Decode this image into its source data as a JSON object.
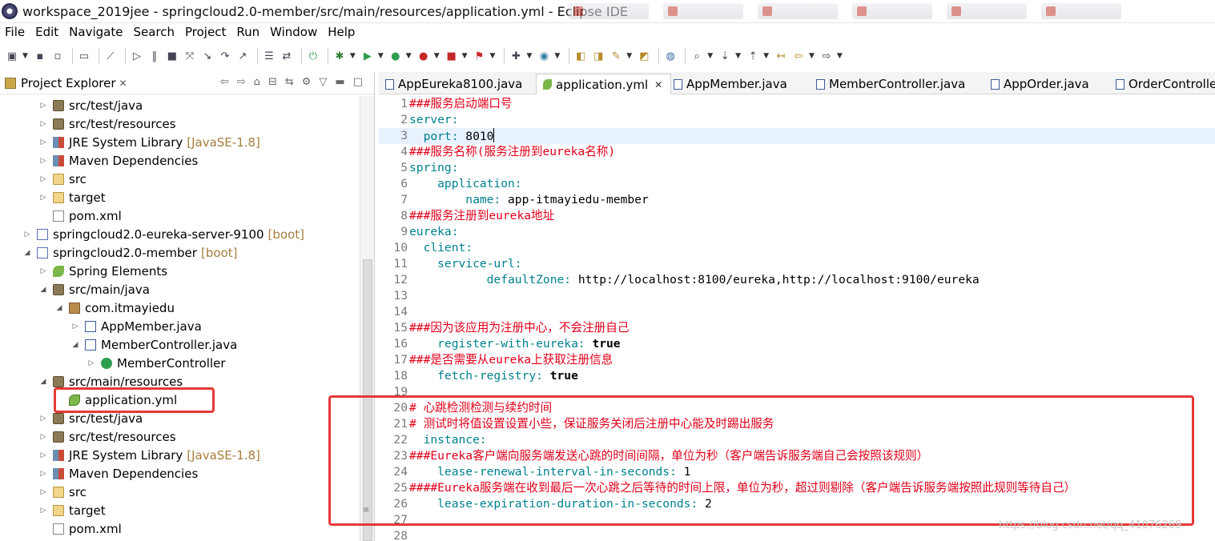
{
  "window": {
    "title": "workspace_2019jee - springcloud2.0-member/src/main/resources/application.yml - Eclipse IDE"
  },
  "menu": [
    "File",
    "Edit",
    "Navigate",
    "Search",
    "Project",
    "Run",
    "Window",
    "Help"
  ],
  "explorer": {
    "title": "Project Explorer",
    "close": "✕",
    "rows": [
      {
        "label": "src/test/java",
        "icon": "package-folder-icon",
        "twisty": "collapsed"
      },
      {
        "label": "src/test/resources",
        "icon": "package-folder-icon",
        "twisty": "collapsed"
      },
      {
        "label": "JRE System Library",
        "decoration": "[JavaSE-1.8]",
        "icon": "library-icon",
        "twisty": "collapsed"
      },
      {
        "label": "Maven Dependencies",
        "icon": "library-icon",
        "twisty": "collapsed"
      },
      {
        "label": "src",
        "icon": "folder-icon",
        "twisty": "collapsed"
      },
      {
        "label": "target",
        "icon": "folder-icon",
        "twisty": "collapsed"
      },
      {
        "label": "pom.xml",
        "icon": "xml-file-icon",
        "twisty": "none"
      },
      {
        "label": "springcloud2.0-eureka-server-9100",
        "decoration": "[boot]",
        "icon": "maven-project-icon",
        "twisty": "collapsed"
      },
      {
        "label": "springcloud2.0-member",
        "decoration": "[boot]",
        "icon": "maven-project-icon",
        "twisty": "expanded"
      },
      {
        "label": "Spring Elements",
        "icon": "spring-icon",
        "twisty": "collapsed"
      },
      {
        "label": "src/main/java",
        "icon": "package-folder-icon",
        "twisty": "expanded"
      },
      {
        "label": "com.itmayiedu",
        "icon": "package-icon",
        "twisty": "expanded"
      },
      {
        "label": "AppMember.java",
        "icon": "java-file-icon",
        "twisty": "collapsed"
      },
      {
        "label": "MemberController.java",
        "icon": "java-file-icon",
        "twisty": "expanded"
      },
      {
        "label": "MemberController",
        "icon": "class-icon",
        "twisty": "collapsed"
      },
      {
        "label": "src/main/resources",
        "icon": "package-folder-icon",
        "twisty": "expanded"
      },
      {
        "label": "application.yml",
        "icon": "yml-file-icon",
        "twisty": "none"
      },
      {
        "label": "src/test/java",
        "icon": "package-folder-icon",
        "twisty": "collapsed"
      },
      {
        "label": "src/test/resources",
        "icon": "package-folder-icon",
        "twisty": "collapsed"
      },
      {
        "label": "JRE System Library",
        "decoration": "[JavaSE-1.8]",
        "icon": "library-icon",
        "twisty": "collapsed"
      },
      {
        "label": "Maven Dependencies",
        "icon": "library-icon",
        "twisty": "collapsed"
      },
      {
        "label": "src",
        "icon": "folder-icon",
        "twisty": "collapsed"
      },
      {
        "label": "target",
        "icon": "folder-icon",
        "twisty": "collapsed"
      },
      {
        "label": "pom.xml",
        "icon": "xml-file-icon",
        "twisty": "none"
      }
    ]
  },
  "editor": {
    "tabs": [
      {
        "label": "AppEureka8100.java",
        "active": false
      },
      {
        "label": "application.yml",
        "active": true,
        "close": "✕"
      },
      {
        "label": "AppMember.java",
        "active": false
      },
      {
        "label": "MemberController.java",
        "active": false
      },
      {
        "label": "AppOrder.java",
        "active": false
      },
      {
        "label": "OrderControlle",
        "active": false
      }
    ],
    "lines": [
      {
        "n": "1",
        "tokens": [
          {
            "t": "###服务启动端口号",
            "c": "comment"
          }
        ]
      },
      {
        "n": "2",
        "tokens": [
          {
            "t": "server:",
            "c": "key"
          }
        ]
      },
      {
        "n": "3",
        "tokens": [
          {
            "t": "  port: ",
            "c": "key"
          },
          {
            "t": "8010",
            "c": "val"
          }
        ],
        "current": true
      },
      {
        "n": "4",
        "tokens": [
          {
            "t": "###服务名称(服务注册到eureka名称)",
            "c": "comment"
          }
        ]
      },
      {
        "n": "5",
        "tokens": [
          {
            "t": "spring:",
            "c": "key"
          }
        ]
      },
      {
        "n": "6",
        "tokens": [
          {
            "t": "    application:",
            "c": "key"
          }
        ]
      },
      {
        "n": "7",
        "tokens": [
          {
            "t": "        name: ",
            "c": "key"
          },
          {
            "t": "app-itmayiedu-member",
            "c": "val"
          }
        ]
      },
      {
        "n": "8",
        "tokens": [
          {
            "t": "###服务注册到eureka地址",
            "c": "comment"
          }
        ]
      },
      {
        "n": "9",
        "tokens": [
          {
            "t": "eureka:",
            "c": "key"
          }
        ]
      },
      {
        "n": "10",
        "tokens": [
          {
            "t": "  client:",
            "c": "key"
          }
        ]
      },
      {
        "n": "11",
        "tokens": [
          {
            "t": "    service-url:",
            "c": "key"
          }
        ]
      },
      {
        "n": "12",
        "tokens": [
          {
            "t": "           defaultZone: ",
            "c": "key"
          },
          {
            "t": "http://localhost:8100/eureka,http://localhost:9100/eureka",
            "c": "val"
          }
        ]
      },
      {
        "n": "13",
        "tokens": []
      },
      {
        "n": "14",
        "tokens": []
      },
      {
        "n": "15",
        "tokens": [
          {
            "t": "###因为该应用为注册中心，不会注册自己",
            "c": "comment"
          }
        ]
      },
      {
        "n": "16",
        "tokens": [
          {
            "t": "    register-with-eureka: ",
            "c": "key"
          },
          {
            "t": "true",
            "c": "kw"
          }
        ]
      },
      {
        "n": "17",
        "tokens": [
          {
            "t": "###是否需要从eureka上获取注册信息",
            "c": "comment"
          }
        ]
      },
      {
        "n": "18",
        "tokens": [
          {
            "t": "    fetch-registry: ",
            "c": "key"
          },
          {
            "t": "true",
            "c": "kw"
          }
        ]
      },
      {
        "n": "19",
        "tokens": []
      },
      {
        "n": "20",
        "tokens": [
          {
            "t": "# 心跳检测检测与续约时间",
            "c": "comment"
          }
        ]
      },
      {
        "n": "21",
        "tokens": [
          {
            "t": "# 测试时将值设置设置小些，保证服务关闭后注册中心能及时踢出服务",
            "c": "comment"
          }
        ]
      },
      {
        "n": "22",
        "tokens": [
          {
            "t": "  instance:",
            "c": "key"
          }
        ]
      },
      {
        "n": "23",
        "tokens": [
          {
            "t": "###Eureka客户端向服务端发送心跳的时间间隔，单位为秒（客户端告诉服务端自己会按照该规则）",
            "c": "comment"
          }
        ]
      },
      {
        "n": "24",
        "tokens": [
          {
            "t": "    lease-renewal-interval-in-seconds: ",
            "c": "key"
          },
          {
            "t": "1",
            "c": "val"
          }
        ]
      },
      {
        "n": "25",
        "tokens": [
          {
            "t": "####Eureka服务端在收到最后一次心跳之后等待的时间上限，单位为秒，超过则剔除（客户端告诉服务端按照此规则等待自己）",
            "c": "comment"
          }
        ]
      },
      {
        "n": "26",
        "tokens": [
          {
            "t": "    lease-expiration-duration-in-seconds: ",
            "c": "key"
          },
          {
            "t": "2",
            "c": "val"
          }
        ]
      },
      {
        "n": "27",
        "tokens": []
      },
      {
        "n": "28",
        "tokens": []
      }
    ]
  },
  "watermark": "https://blog.csdn.net/qq_41076269",
  "colors": {
    "comment": "#e0001a",
    "key": "#00808f",
    "annotation_box": "#e53935",
    "current_line": "#e8f2fe"
  }
}
